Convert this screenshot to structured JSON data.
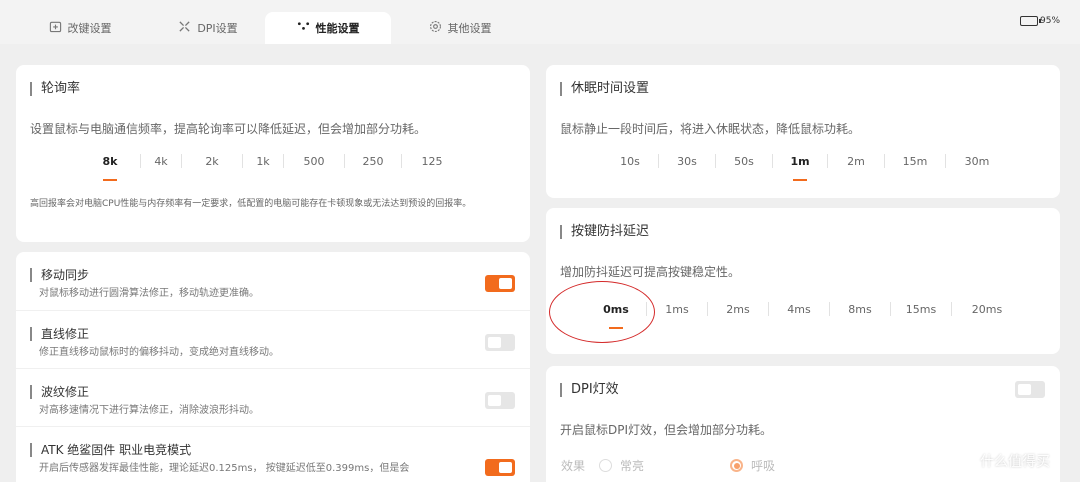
{
  "tabs": [
    {
      "label": "改键设置",
      "icon": "keymap-icon"
    },
    {
      "label": "DPI设置",
      "icon": "crosshair-icon"
    },
    {
      "label": "性能设置",
      "icon": "performance-icon",
      "active": true
    },
    {
      "label": "其他设置",
      "icon": "gear-icon"
    }
  ],
  "battery": {
    "percent": "95%",
    "color": "#2fbe45"
  },
  "accent_color": "#f26b1d",
  "polling": {
    "title": "轮询率",
    "desc": "设置鼠标与电脑通信频率，提高轮询率可以降低延迟，但会增加部分功耗。",
    "options": [
      "8k",
      "4k",
      "2k",
      "1k",
      "500",
      "250",
      "125"
    ],
    "selected": "8k",
    "note": "高回报率会对电脑CPU性能与内存频率有一定要求，低配置的电脑可能存在卡顿现象或无法达到预设的回报率。"
  },
  "sleep": {
    "title": "休眠时间设置",
    "desc": "鼠标静止一段时间后，将进入休眠状态，降低鼠标功耗。",
    "options": [
      "10s",
      "30s",
      "50s",
      "1m",
      "2m",
      "15m",
      "30m"
    ],
    "selected": "1m"
  },
  "debounce": {
    "title": "按键防抖延迟",
    "desc": "增加防抖延迟可提高按键稳定性。",
    "options": [
      "0ms",
      "1ms",
      "2ms",
      "4ms",
      "8ms",
      "15ms",
      "20ms"
    ],
    "selected": "0ms"
  },
  "features": [
    {
      "title": "移动同步",
      "desc": "对鼠标移动进行圆滑算法修正，移动轨迹更准确。",
      "on": true
    },
    {
      "title": "直线修正",
      "desc": "修正直线移动鼠标时的偏移抖动，变成绝对直线移动。",
      "on": false
    },
    {
      "title": "波纹修正",
      "desc": "对高移速情况下进行算法修正，消除波浪形抖动。",
      "on": false
    },
    {
      "title": "ATK 绝鲨固件 职业电竞模式",
      "desc": "开启后传感器发挥最佳性能，理论延迟0.125ms， 按键延迟低至0.399ms，但是会",
      "on": true
    }
  ],
  "dpi_light": {
    "title": "DPI灯效",
    "desc": "开启鼠标DPI灯效，但会增加部分功耗。",
    "on": false,
    "effect_label": "效果",
    "options": [
      "常亮",
      "呼吸"
    ],
    "selected": "呼吸"
  },
  "watermark": "什么值得买"
}
